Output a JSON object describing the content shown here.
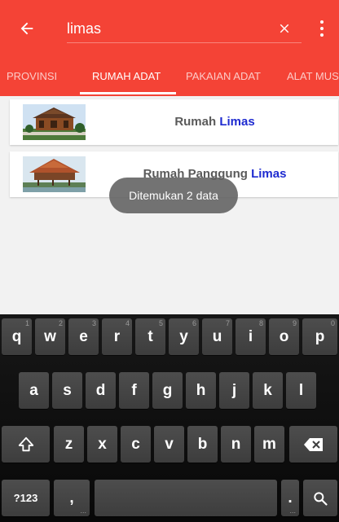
{
  "toolbar": {
    "back_icon": "arrow-left-icon",
    "search_value": "limas",
    "clear_icon": "close-icon",
    "more_icon": "more-vert-icon",
    "background": "#f44336"
  },
  "tabs": [
    {
      "label": "PROVINSI",
      "active": false
    },
    {
      "label": "RUMAH ADAT",
      "active": true
    },
    {
      "label": "PAKAIAN ADAT",
      "active": false
    },
    {
      "label": "ALAT MUS",
      "active": false
    }
  ],
  "results": [
    {
      "title_prefix": "Rumah ",
      "title_highlight": "Limas"
    },
    {
      "title_prefix": "Rumah Panggung ",
      "title_highlight": "Limas"
    }
  ],
  "toast": {
    "text": "Ditemukan 2 data"
  },
  "keyboard": {
    "row1": [
      {
        "key": "q",
        "hint": "1"
      },
      {
        "key": "w",
        "hint": "2"
      },
      {
        "key": "e",
        "hint": "3"
      },
      {
        "key": "r",
        "hint": "4"
      },
      {
        "key": "t",
        "hint": "5"
      },
      {
        "key": "y",
        "hint": "6"
      },
      {
        "key": "u",
        "hint": "7"
      },
      {
        "key": "i",
        "hint": "8"
      },
      {
        "key": "o",
        "hint": "9"
      },
      {
        "key": "p",
        "hint": "0"
      }
    ],
    "row2": [
      "a",
      "s",
      "d",
      "f",
      "g",
      "h",
      "j",
      "k",
      "l"
    ],
    "row3": [
      "z",
      "x",
      "c",
      "v",
      "b",
      "n",
      "m"
    ],
    "shift_icon": "shift-icon",
    "backspace_icon": "backspace-icon",
    "symbols_label": "?123",
    "comma_label": ",",
    "period_label": ".",
    "search_icon": "search-icon",
    "more_keys_hint": "..."
  }
}
